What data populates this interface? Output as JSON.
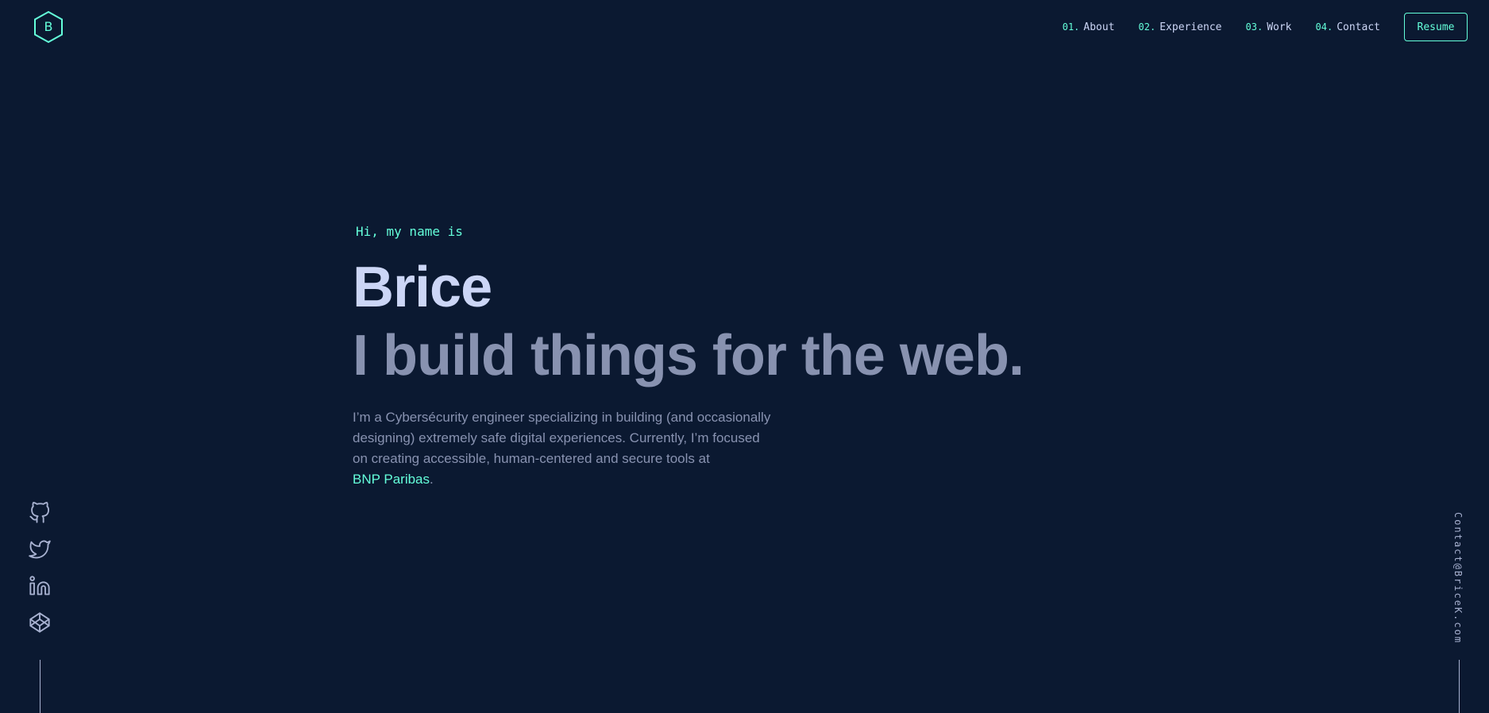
{
  "logo": {
    "letter": "B",
    "icon": "hexagon-logo-icon",
    "color": "#64ffda"
  },
  "nav": {
    "items": [
      {
        "num": "01.",
        "label": "About"
      },
      {
        "num": "02.",
        "label": "Experience"
      },
      {
        "num": "03.",
        "label": "Work"
      },
      {
        "num": "04.",
        "label": "Contact"
      }
    ],
    "resume_label": "Resume"
  },
  "hero": {
    "greeting": "Hi, my name is",
    "name": "Brice",
    "tagline": "I build things for the web.",
    "bio_lines": [
      "I’m a Cybersécurity engineer specializing in building (and occasionally",
      "designing) extremely safe digital experiences. Currently, I’m focused",
      "on creating accessible, human-centered and secure tools at"
    ],
    "bio_link": "BNP Paribas",
    "bio_end": "."
  },
  "social": {
    "icons": [
      "github-icon",
      "twitter-icon",
      "linkedin-icon",
      "codepen-icon"
    ]
  },
  "email": "Contact@BriceK.com",
  "colors": {
    "background": "#0b1931",
    "accent": "#64ffda",
    "heading": "#ccd6f6",
    "text": "#8892b0",
    "light": "#a8b2d1"
  }
}
